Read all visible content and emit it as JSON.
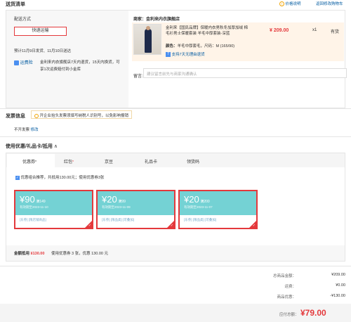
{
  "header": {
    "title": "送货清单",
    "price_help": "价格说明",
    "back_to_cart": "返回修改购物车"
  },
  "shipping": {
    "label": "配送方式",
    "option": "快递运输",
    "eta": "预计11月9日发货、11月10日送达",
    "service_tag": "运费险",
    "service_desc": "金利来内衣旗舰店7天内退货，15天内换货，可享1次运费赔付到小金库"
  },
  "seller": {
    "label": "商家：",
    "name": "金利来内衣旗舰店"
  },
  "product": {
    "title": "金利来【国民品牌】保暖内衣男秋冬加厚加绒 棉毛衫男士保暖套装 羊毛中厚套装-深蓝",
    "price": "¥ 209.00",
    "qty": "x1",
    "stock": "有货",
    "color_label": "颜色：",
    "color_value": "羊毛中厚套毛，尺码：M (165/90)",
    "return_badge": "7",
    "return_text": "支持7天无理由退货"
  },
  "note": {
    "label": "留言:",
    "placeholder": "建议留言前先与商家沟通确认"
  },
  "invoice": {
    "title": "发票信息",
    "tip": "开企业抬头发票须填写纳税人识别号，以免影响报销",
    "status": "不开发票",
    "edit": "修改"
  },
  "coupons": {
    "title": "使用优惠/礼品卡/抵用",
    "tabs": [
      "优惠券",
      "红包",
      "京豆",
      "礼品卡",
      "领货码"
    ],
    "tab_marks": [
      "*",
      "*",
      "",
      "",
      ""
    ],
    "combo_text": "优惠组合推荐，共抵用130.00元；使用优惠券3张",
    "items": [
      {
        "amount": "¥90",
        "cond": "满149",
        "date": "有效期至2023-11-10",
        "tags": "[东券]  [限店铺商品]"
      },
      {
        "amount": "¥20",
        "cond": "满99",
        "date": "有效期至2023-11-09",
        "tags": "[东券]  [限品类]  [可叠加]"
      },
      {
        "amount": "¥20",
        "cond": "满200",
        "date": "有效期至2023-11-07",
        "tags": "[东券]  [限品类]  [可叠加]"
      }
    ],
    "deduct_label": "金额抵用",
    "deduct_amount": "¥130.00",
    "deduct_desc": "使用优惠券 3 张，优惠 130.00 元"
  },
  "summary": {
    "rows": [
      {
        "label": "总商品金额：",
        "value": "¥209.00"
      },
      {
        "label": "运费：",
        "value": "¥0.00"
      },
      {
        "label": "商品优惠：",
        "value": "-¥130.00"
      }
    ],
    "total_label": "应付总额：",
    "total_value": "¥79.00"
  },
  "colors": {
    "accent_red": "#e4393c",
    "coupon_teal": "#74d2d4",
    "link_blue": "#005aa0"
  }
}
